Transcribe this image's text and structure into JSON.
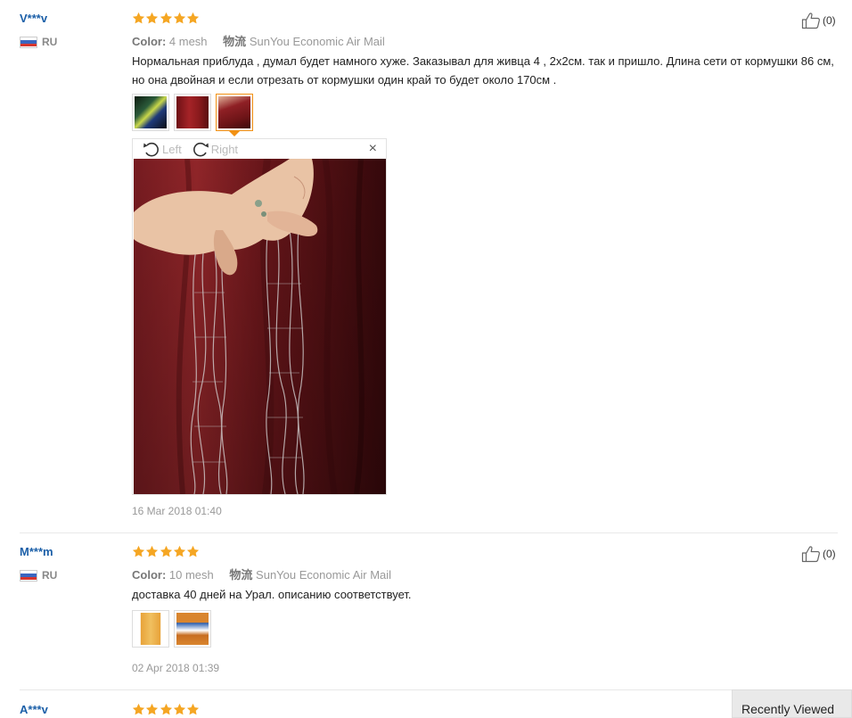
{
  "reviews": [
    {
      "user": "V***v",
      "country": "RU",
      "rating": 5,
      "color_label": "Color:",
      "color_value": "4 mesh",
      "shipping_label": "物流",
      "shipping_value": "SunYou Economic Air Mail",
      "helpful_count": "(0)",
      "text": "Нормальная приблуда , думал будет намного хуже. Заказывал для живца 4 , 2х2см. так и пришло. Длина сети от кормушки 86 см, но она двойная и если отрезать от кормушки один край то будет около 170см .",
      "date": "16 Mar 2018 01:40",
      "viewer": {
        "rotate_left": "Left",
        "rotate_right": "Right",
        "close": "×"
      }
    },
    {
      "user": "M***m",
      "country": "RU",
      "rating": 5,
      "color_label": "Color:",
      "color_value": "10 mesh",
      "shipping_label": "物流",
      "shipping_value": "SunYou Economic Air Mail",
      "helpful_count": "(0)",
      "text": "доставка 40 дней на Урал. описанию соответствует.",
      "date": "02 Apr 2018 01:39"
    },
    {
      "user": "A***v",
      "rating": 5
    }
  ],
  "recently_viewed": "Recently Viewed",
  "colors": {
    "user_link": "#1b5fa8",
    "star": "#f5a623",
    "active_thumb": "#f29113"
  },
  "icons": [
    "star-icon",
    "thumbs-up-icon",
    "rotate-left-icon",
    "rotate-right-icon",
    "close-icon",
    "flag-ru-icon"
  ]
}
